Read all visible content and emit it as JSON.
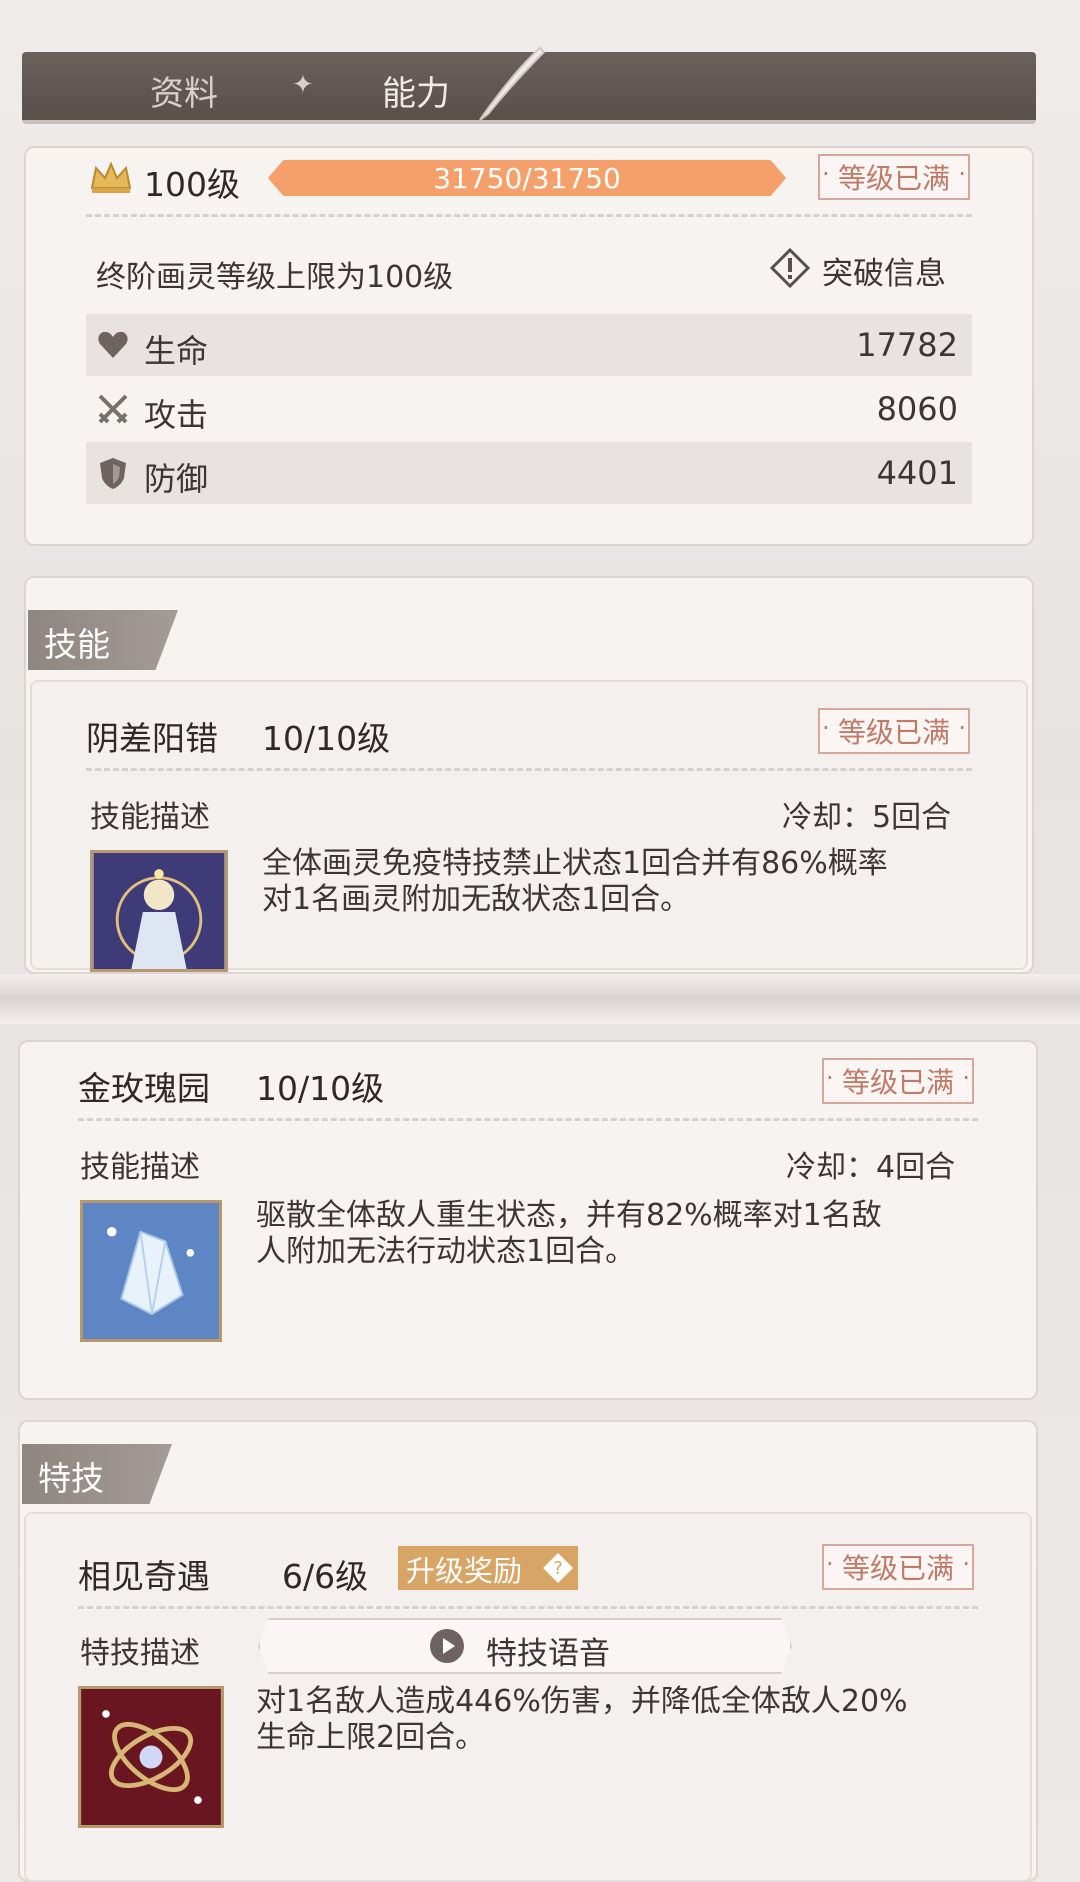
{
  "tabs": {
    "info": "资料",
    "separator": "✦",
    "ability": "能力"
  },
  "level": {
    "label": "100级",
    "progress_text": "31750/31750",
    "progress_fraction": 1.0,
    "max_badge": "等级已满",
    "cap_note": "终阶画灵等级上限为100级",
    "breakthrough_label": "突破信息"
  },
  "stats": [
    {
      "icon": "heart-icon",
      "label": "生命",
      "value": "17782"
    },
    {
      "icon": "swords-icon",
      "label": "攻击",
      "value": "8060"
    },
    {
      "icon": "shield-icon",
      "label": "防御",
      "value": "4401"
    }
  ],
  "skills_section": {
    "title": "技能"
  },
  "skill1": {
    "name": "阴差阳错",
    "level": "10/10级",
    "max_badge": "等级已满",
    "desc_label": "技能描述",
    "cooldown": "冷却：5回合",
    "description_line1": "全体画灵免疫特技禁止状态1回合并有86%概率",
    "description_line2": "对1名画灵附加无敌状态1回合。"
  },
  "skill2": {
    "name": "金玫瑰园",
    "level": "10/10级",
    "max_badge": "等级已满",
    "desc_label": "技能描述",
    "cooldown": "冷却：4回合",
    "description_line1": "驱散全体敌人重生状态，并有82%概率对1名敌",
    "description_line2": "人附加无法行动状态1回合。"
  },
  "special_section": {
    "title": "特技"
  },
  "special": {
    "name": "相见奇遇",
    "level": "6/6级",
    "reward_label": "升级奖励",
    "max_badge": "等级已满",
    "desc_label": "特技描述",
    "voice_label": "特技语音",
    "description_line1": "对1名敌人造成446%伤害，并降低全体敌人20%",
    "description_line2": "生命上限2回合。"
  },
  "colors": {
    "accent_orange": "#f4a36a",
    "badge_red": "#c07a68",
    "tabbar": "#5f5450",
    "reward_gold": "#d8a566"
  }
}
